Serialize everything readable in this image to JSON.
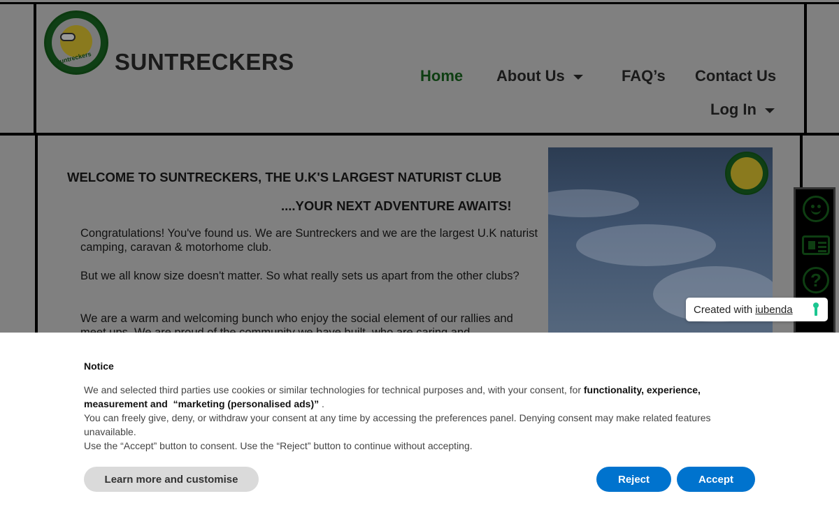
{
  "site": {
    "brand": "SUNTRECKERS",
    "logo_text": "suntreckers",
    "nav": {
      "home": "Home",
      "about": "About Us",
      "faq": "FAQ’s",
      "contact": "Contact Us",
      "login": "Log In"
    },
    "welcome_heading": "WELCOME TO SUNTRECKERS, THE U.K'S LARGEST NATURIST CLUB",
    "adventure_heading": "....YOUR NEXT ADVENTURE AWAITS!",
    "paragraphs": [
      "Congratulations! You've found us. We are Suntreckers and we are the largest U.K naturist camping, caravan & motorhome club.",
      "But we all know size doesn't matter. So what really sets us apart from the other clubs?",
      "We are a warm and welcoming bunch who enjoy the social element of our rallies and meet ups. We are proud of the community we have built, who are caring and"
    ]
  },
  "iubenda": {
    "prefix": "Created with",
    "link": "iubenda"
  },
  "cookie_banner": {
    "title": "Notice",
    "line1_normal": "We and selected third parties use cookies or similar technologies for technical purposes and, with your consent, for ",
    "line1_bold": "functionality, experience, measurement and",
    "line1_quoted": "“marketing (personalised ads)”",
    "line1_end": ".",
    "line2": "You can freely give, deny, or withdraw your consent at any time by accessing the preferences panel. Denying consent may make related features unavailable.",
    "line3": "Use the “Accept” button to consent. Use the “Reject” button to continue without accepting.",
    "buttons": {
      "learn_more": "Learn more and customise",
      "reject": "Reject",
      "accept": "Accept"
    }
  }
}
